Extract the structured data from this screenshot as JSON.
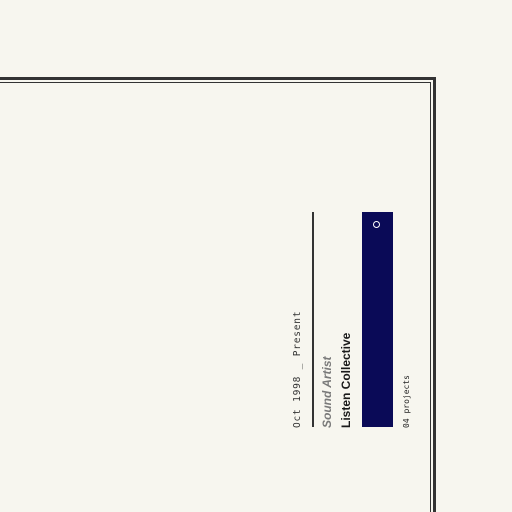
{
  "entry": {
    "date_range": "Oct 1998 _ Present",
    "role": "Sound Artist",
    "organization": "Listen Collective",
    "project_count": "04 projects"
  },
  "colors": {
    "background": "#f7f6ef",
    "frame": "#333333",
    "accent_bar": "#0a0a57",
    "role_text": "#7a7a7a"
  },
  "icons": {
    "bar_marker": "circle-outline-icon"
  }
}
